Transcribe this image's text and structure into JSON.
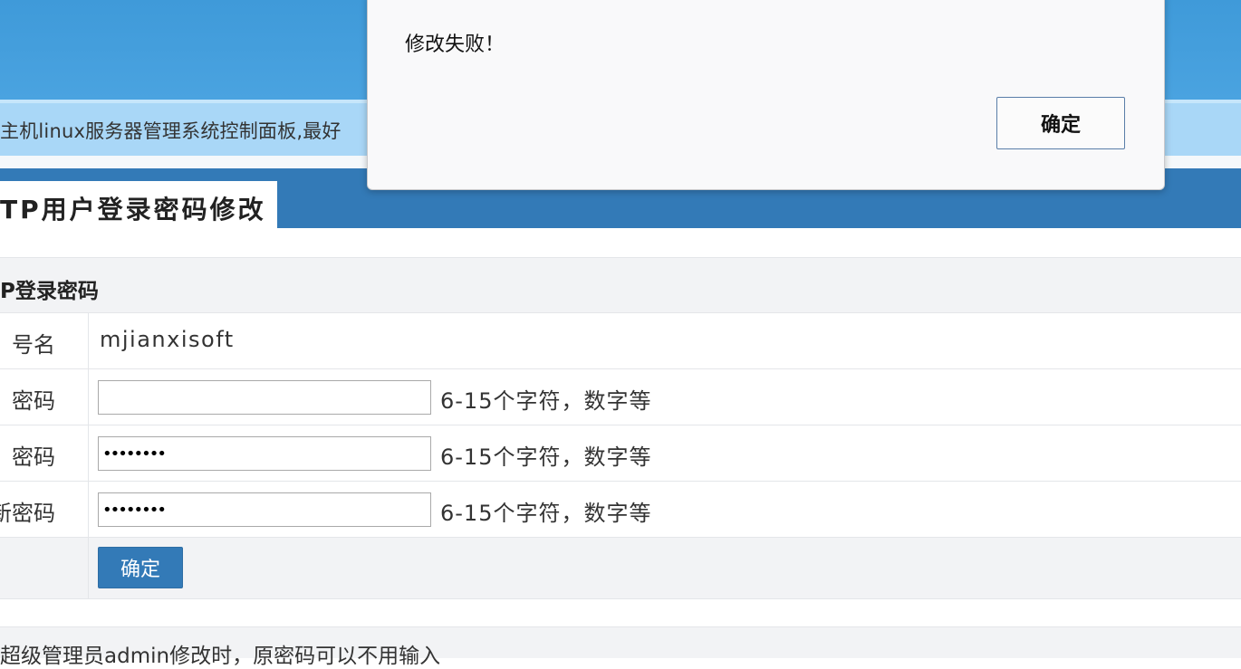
{
  "marquee_text": "主机linux服务器管理系统控制面板,最好",
  "page_title": "TP用户登录密码修改",
  "section_title": "P登录密码",
  "rows": [
    {
      "label": "号名",
      "value": "mjianxisoft"
    },
    {
      "label": "密码",
      "input_value": "",
      "hint": "6-15个字符，数字等"
    },
    {
      "label": "密码",
      "input_value": "••••••••",
      "hint": "6-15个字符，数字等"
    },
    {
      "label": "新密码",
      "input_value": "••••••••",
      "hint": "6-15个字符，数字等"
    }
  ],
  "submit_label": "确定",
  "note_text": "超级管理员admin修改时，原密码可以不用输入",
  "dialog": {
    "message": "修改失败！",
    "ok_label": "确定"
  },
  "colors": {
    "banner": "#4aa3e0",
    "marquee": "#a9d7f7",
    "title_bar": "#337ab7",
    "button": "#337ab7"
  }
}
